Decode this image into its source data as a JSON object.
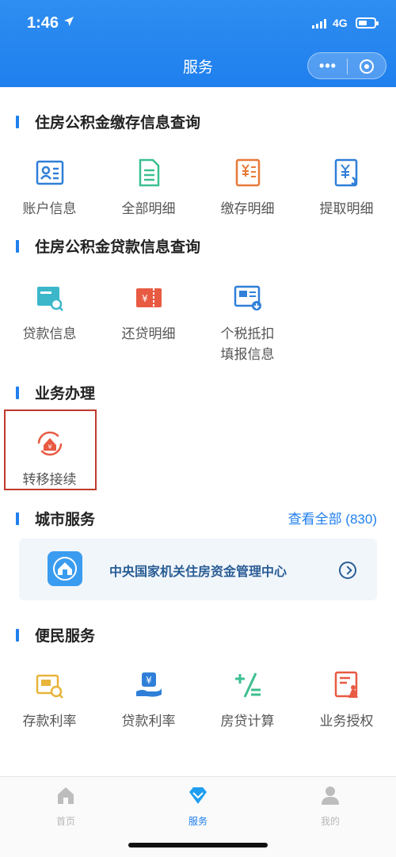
{
  "status_bar": {
    "time": "1:46",
    "network": "4G"
  },
  "nav": {
    "title": "服务"
  },
  "sections": {
    "deposit": {
      "title": "住房公积金缴存信息查询",
      "items": [
        "账户信息",
        "全部明细",
        "缴存明细",
        "提取明细"
      ]
    },
    "loan": {
      "title": "住房公积金贷款信息查询",
      "items": [
        "贷款信息",
        "还贷明细",
        "个税抵扣\n填报信息"
      ]
    },
    "business": {
      "title": "业务办理",
      "items": [
        "转移接续"
      ]
    },
    "city": {
      "title": "城市服务",
      "view_all": "查看全部 (830)",
      "card_name": "中央国家机关住房资金管理中心"
    },
    "convenience": {
      "title": "便民服务",
      "items": [
        "存款利率",
        "贷款利率",
        "房贷计算",
        "业务授权"
      ]
    }
  },
  "tabbar": {
    "home": "首页",
    "service": "服务",
    "mine": "我的"
  },
  "colors": {
    "primary": "#1f7fee",
    "highlight_border": "#c0392b"
  }
}
